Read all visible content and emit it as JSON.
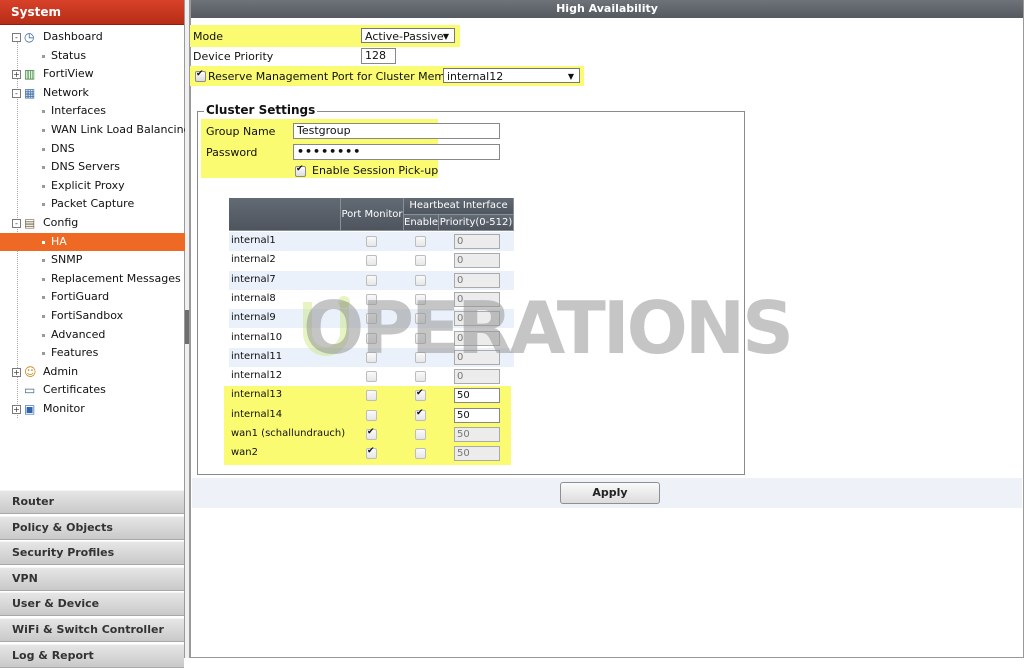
{
  "sidebar": {
    "header": "System",
    "tree": [
      {
        "label": "Dashboard",
        "level": 0,
        "icon": "dashboard-icon",
        "toggle": "-"
      },
      {
        "label": "Status",
        "level": 1
      },
      {
        "label": "FortiView",
        "level": 0,
        "icon": "fortiview-icon",
        "toggle": "+"
      },
      {
        "label": "Network",
        "level": 0,
        "icon": "network-icon",
        "toggle": "-"
      },
      {
        "label": "Interfaces",
        "level": 1
      },
      {
        "label": "WAN Link Load Balancing",
        "level": 1
      },
      {
        "label": "DNS",
        "level": 1
      },
      {
        "label": "DNS Servers",
        "level": 1
      },
      {
        "label": "Explicit Proxy",
        "level": 1
      },
      {
        "label": "Packet Capture",
        "level": 1
      },
      {
        "label": "Config",
        "level": 0,
        "icon": "config-icon",
        "toggle": "-"
      },
      {
        "label": "HA",
        "level": 1,
        "selected": true
      },
      {
        "label": "SNMP",
        "level": 1
      },
      {
        "label": "Replacement Messages",
        "level": 1
      },
      {
        "label": "FortiGuard",
        "level": 1
      },
      {
        "label": "FortiSandbox",
        "level": 1
      },
      {
        "label": "Advanced",
        "level": 1
      },
      {
        "label": "Features",
        "level": 1
      },
      {
        "label": "Admin",
        "level": 0,
        "icon": "admin-icon",
        "toggle": "+"
      },
      {
        "label": "Certificates",
        "level": 0,
        "icon": "certificate-icon"
      },
      {
        "label": "Monitor",
        "level": 0,
        "icon": "monitor-icon",
        "toggle": "+"
      }
    ],
    "sections": [
      "Router",
      "Policy & Objects",
      "Security Profiles",
      "VPN",
      "User & Device",
      "WiFi & Switch Controller",
      "Log & Report"
    ]
  },
  "page": {
    "title": "High Availability",
    "mode_label": "Mode",
    "mode_value": "Active-Passive",
    "priority_label": "Device Priority",
    "priority_value": "128",
    "reserve_label": "Reserve Management Port for Cluster Member",
    "reserve_checked": true,
    "reserve_value": "internal12",
    "cluster_legend": "Cluster Settings",
    "group_label": "Group Name",
    "group_value": "Testgroup",
    "password_label": "Password",
    "password_value": "••••••••",
    "pickup_label": "Enable Session Pick-up",
    "pickup_checked": true,
    "apply_label": "Apply"
  },
  "hb_table": {
    "col_port_monitor": "Port Monitor",
    "col_heartbeat": "Heartbeat Interface",
    "col_enable": "Enable",
    "col_priority": "Priority(0-512)",
    "rows": [
      {
        "name": "internal1",
        "port_monitor": false,
        "enable": false,
        "priority": "0"
      },
      {
        "name": "internal2",
        "port_monitor": false,
        "enable": false,
        "priority": "0"
      },
      {
        "name": "internal7",
        "port_monitor": false,
        "enable": false,
        "priority": "0"
      },
      {
        "name": "internal8",
        "port_monitor": false,
        "enable": false,
        "priority": "0"
      },
      {
        "name": "internal9",
        "port_monitor": false,
        "enable": false,
        "priority": "0"
      },
      {
        "name": "internal10",
        "port_monitor": false,
        "enable": false,
        "priority": "0"
      },
      {
        "name": "internal11",
        "port_monitor": false,
        "enable": false,
        "priority": "0"
      },
      {
        "name": "internal12",
        "port_monitor": false,
        "enable": false,
        "priority": "0"
      },
      {
        "name": "internal13",
        "port_monitor": false,
        "enable": true,
        "priority": "50"
      },
      {
        "name": "internal14",
        "port_monitor": false,
        "enable": true,
        "priority": "50"
      },
      {
        "name": "wan1 (schallundrauch)",
        "port_monitor": true,
        "enable": false,
        "priority": "50"
      },
      {
        "name": "wan2",
        "port_monitor": true,
        "enable": false,
        "priority": "50"
      }
    ]
  },
  "watermark": "OPERATIONS",
  "colors": {
    "highlight": "#fbfb72",
    "selected": "#ee6a24",
    "header": "#c6351c"
  }
}
